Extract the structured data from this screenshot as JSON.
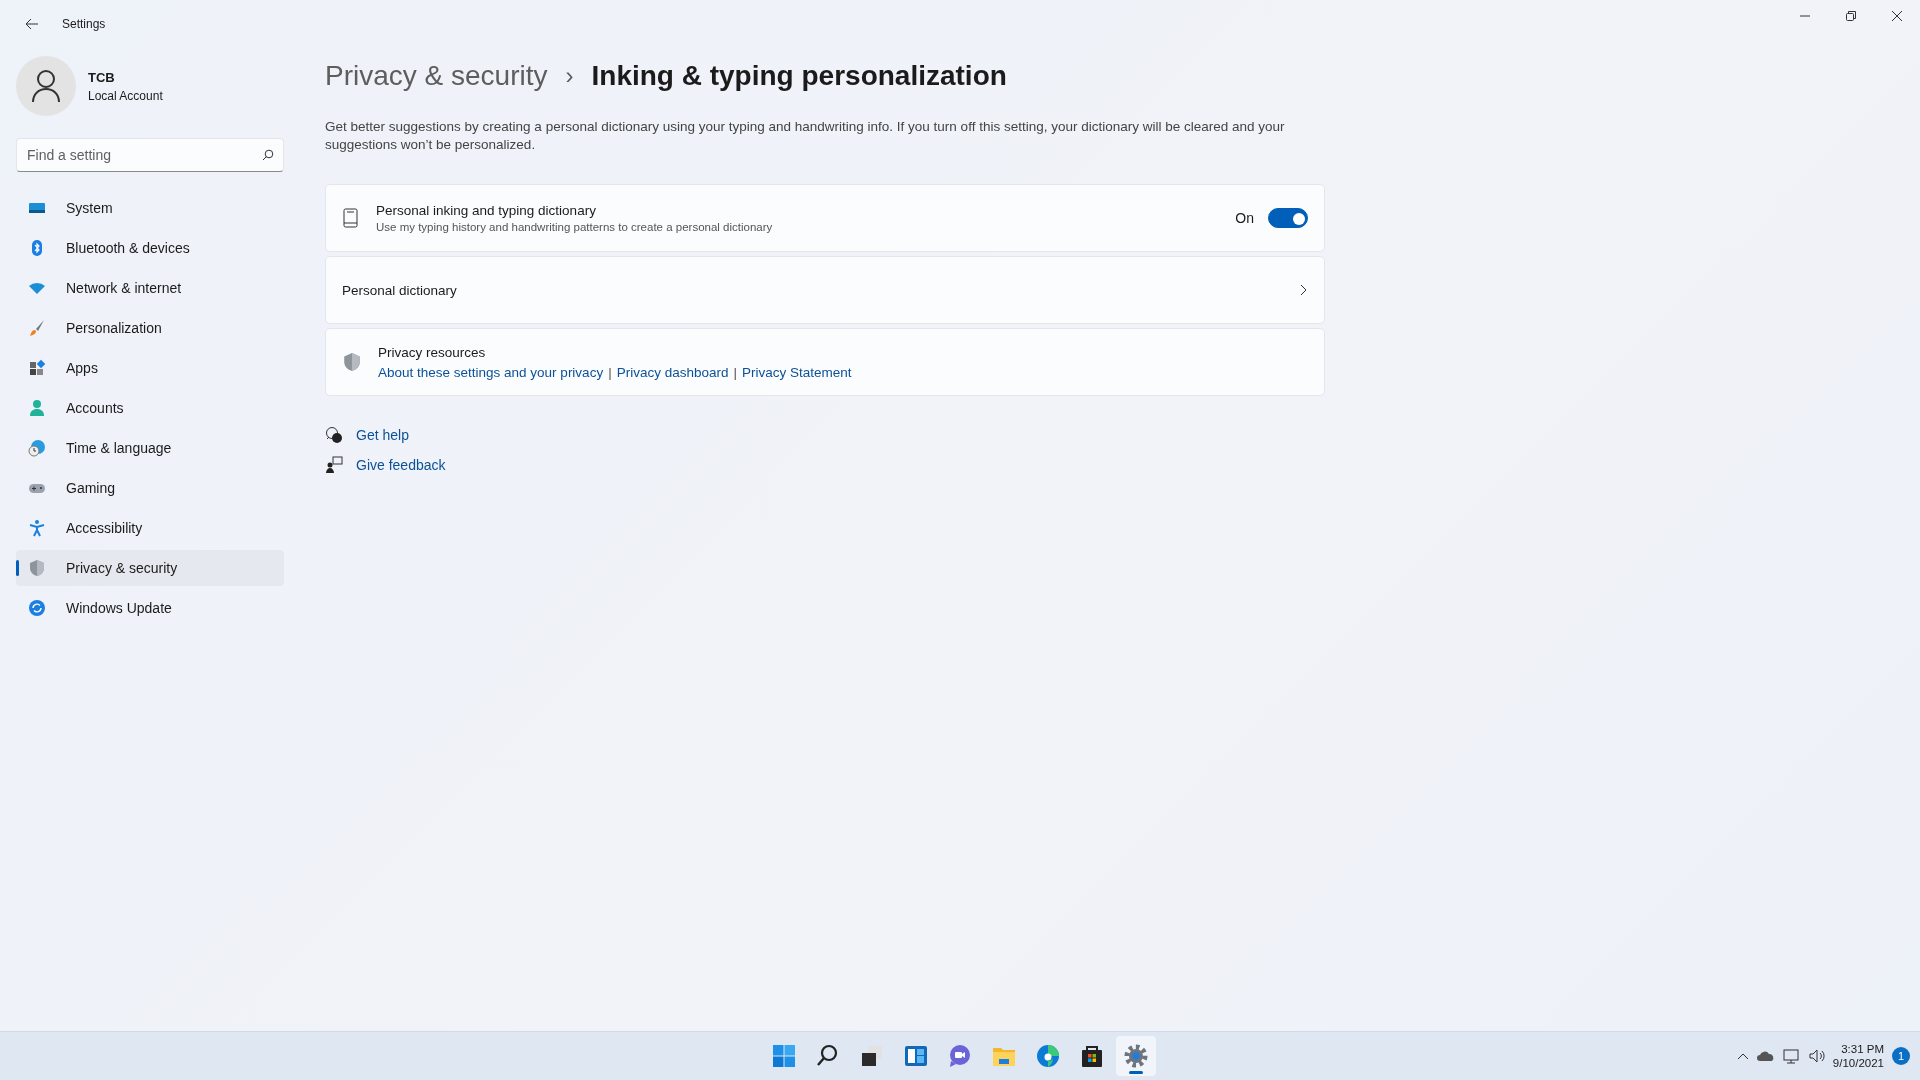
{
  "window": {
    "title": "Settings"
  },
  "profile": {
    "name": "TCB",
    "account": "Local Account"
  },
  "search": {
    "placeholder": "Find a setting"
  },
  "nav": [
    {
      "label": "System",
      "selected": false
    },
    {
      "label": "Bluetooth & devices",
      "selected": false
    },
    {
      "label": "Network & internet",
      "selected": false
    },
    {
      "label": "Personalization",
      "selected": false
    },
    {
      "label": "Apps",
      "selected": false
    },
    {
      "label": "Accounts",
      "selected": false
    },
    {
      "label": "Time & language",
      "selected": false
    },
    {
      "label": "Gaming",
      "selected": false
    },
    {
      "label": "Accessibility",
      "selected": false
    },
    {
      "label": "Privacy & security",
      "selected": true
    },
    {
      "label": "Windows Update",
      "selected": false
    }
  ],
  "breadcrumb": {
    "parent": "Privacy & security",
    "separator": "›",
    "current": "Inking & typing personalization"
  },
  "description": "Get better suggestions by creating a personal dictionary using your typing and handwriting info. If you turn off this setting, your dictionary will be cleared and your suggestions won’t be personalized.",
  "cards": [
    {
      "kind": "toggle",
      "title": "Personal inking and typing dictionary",
      "subtitle": "Use my typing history and handwriting patterns to create a personal dictionary",
      "state_label": "On",
      "on": true
    },
    {
      "kind": "link",
      "title": "Personal dictionary"
    },
    {
      "kind": "resources",
      "title": "Privacy resources",
      "links": [
        "About these settings and your privacy",
        "Privacy dashboard",
        "Privacy Statement"
      ],
      "link_separator": "|"
    }
  ],
  "help_links": [
    "Get help",
    "Give feedback"
  ],
  "taskbar": {
    "apps": [
      {
        "selected": false
      },
      {
        "selected": false
      },
      {
        "selected": false
      },
      {
        "selected": false
      },
      {
        "selected": false
      },
      {
        "selected": false
      },
      {
        "selected": false
      },
      {
        "selected": false
      },
      {
        "selected": true
      }
    ],
    "time": "3:31 PM",
    "date": "9/10/2021",
    "notifications": "1"
  }
}
